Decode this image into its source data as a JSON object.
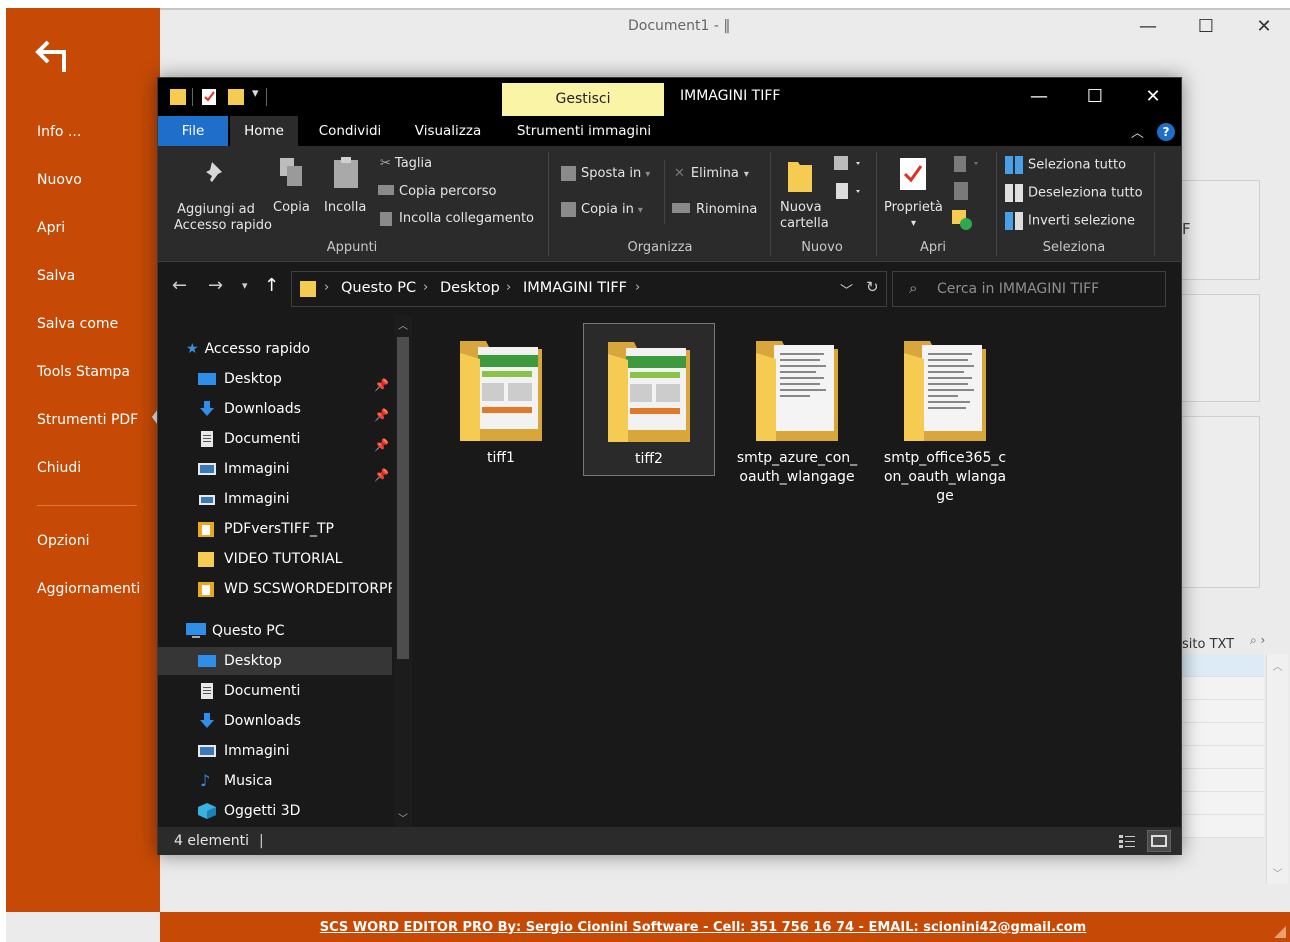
{
  "app": {
    "title": "Document1 - ‖",
    "minimize_glyph": "—",
    "maximize_glyph": "☐",
    "close_glyph": "✕",
    "backstage_color": "#c64a06",
    "backstage": {
      "items": [
        "Info ...",
        "Nuovo",
        "Apri",
        "Salva",
        "Salva come",
        "Tools Stampa",
        "Strumenti  PDF",
        "Chiudi"
      ],
      "lower_items": [
        "Opzioni",
        "Aggiornamenti"
      ]
    },
    "bg_partial_letter": "F",
    "bg_partial_text": "sito TXT",
    "footer_text": "SCS WORD EDITOR PRO By: Sergio Cionini Software - Cell: 351 756 16 74 - EMAIL: scionini42@gmail.com"
  },
  "explorer": {
    "context_tab": "Gestisci",
    "context_color": "#faf4a6",
    "title": "IMMAGINI TIFF",
    "tabs": [
      "File",
      "Home",
      "Condividi",
      "Visualizza",
      "Strumenti immagini"
    ],
    "file_tab_color": "#1d6fc9",
    "help_glyph": "?",
    "ribbon": {
      "appunti": {
        "pin_label_1": "Aggiungi ad",
        "pin_label_2": "Accesso rapido",
        "copy": "Copia",
        "paste": "Incolla",
        "cut": "Taglia",
        "copy_path": "Copia percorso",
        "paste_shortcut": "Incolla collegamento",
        "group": "Appunti"
      },
      "organizza": {
        "move_to": "Sposta in",
        "copy_to": "Copia in",
        "delete": "Elimina",
        "rename": "Rinomina",
        "group": "Organizza"
      },
      "nuovo": {
        "new_folder_1": "Nuova",
        "new_folder_2": "cartella",
        "group": "Nuovo"
      },
      "apri": {
        "properties": "Proprietà",
        "group": "Apri"
      },
      "seleziona": {
        "select_all": "Seleziona tutto",
        "deselect_all": "Deseleziona tutto",
        "invert": "Inverti selezione",
        "group": "Seleziona"
      }
    },
    "address": {
      "crumbs": [
        "Questo PC",
        "Desktop",
        "IMMAGINI TIFF"
      ],
      "search_placeholder": "Cerca in IMMAGINI TIFF"
    },
    "nav": {
      "quick_access": "Accesso rapido",
      "quick_items": [
        "Desktop",
        "Downloads",
        "Documenti",
        "Immagini",
        "Immagini",
        "PDFversTIFF_TP",
        "VIDEO TUTORIAL",
        "WD SCSWORDEDITORPRO"
      ],
      "this_pc": "Questo PC",
      "pc_items": [
        "Desktop",
        "Documenti",
        "Downloads",
        "Immagini",
        "Musica",
        "Oggetti 3D"
      ]
    },
    "files": [
      {
        "name": "tiff1",
        "thumb": "image"
      },
      {
        "name": "tiff2",
        "thumb": "image"
      },
      {
        "name": "smtp_azure_con_oauth_wlangage",
        "thumb": "document"
      },
      {
        "name": "smtp_office365_con_oauth_wlangage",
        "thumb": "document"
      }
    ],
    "status": "4 elementi",
    "status_sep": "|"
  }
}
